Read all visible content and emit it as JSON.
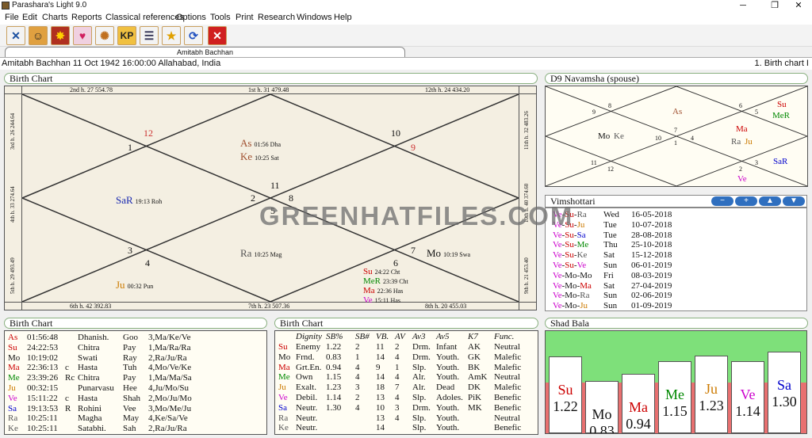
{
  "app": {
    "title": "Parashara's Light 9.0"
  },
  "menu": [
    "File",
    "Edit",
    "Charts",
    "Reports",
    "Classical references",
    "Options",
    "Tools",
    "Print",
    "Research",
    "Windows",
    "Help"
  ],
  "toolbar_icons": [
    "tools-icon",
    "person-icon",
    "sun-icon",
    "heart-icon",
    "wheel-icon",
    "kp-icon",
    "checklist-icon",
    "star-icon",
    "refresh-icon",
    "close-icon"
  ],
  "toolbar_kp": "KP",
  "tab": {
    "label": "Amitabh Bachhan"
  },
  "info": {
    "left": "Amitabh Bachhan 11 Oct 1942 16:00:00  Allahabad, India",
    "right": "1. Birth chart I"
  },
  "birth_chart": {
    "title": "Birth Chart",
    "edge_top": [
      "2nd h.  27  554.78",
      "1st h.  31  479.48",
      "12th h.  24  434.20"
    ],
    "edge_bottom": [
      "6th h.  42  392.83",
      "7th h.  23  507.36",
      "8th h.  20  455.03"
    ],
    "edge_left": [
      "3rd h.  26  244.64",
      "4th h.  33  274.64",
      "5th h.  29  493.49"
    ],
    "edge_right": [
      "11th h.  32  483.26",
      "10th h.  40  374.60",
      "9th h.  21  453.40"
    ],
    "signs": {
      "h1": "11",
      "h2": "12",
      "h3": "1",
      "h4": "2",
      "h5": "3",
      "h6": "4",
      "h7": "5",
      "h8": "6",
      "h9": "7",
      "h10": "8",
      "h11": "9",
      "h12": "10"
    },
    "planets": {
      "as": {
        "name": "As",
        "deg": "01:56 Dha"
      },
      "ke": {
        "name": "Ke",
        "deg": "10:25 Sat"
      },
      "sar": {
        "name": "SaR",
        "deg": "19:13 Roh"
      },
      "ra": {
        "name": "Ra",
        "deg": "10:25 Mag"
      },
      "ju": {
        "name": "Ju",
        "deg": "00:32 Pun"
      },
      "mo": {
        "name": "Mo",
        "deg": "10:19 Swa"
      },
      "su": {
        "name": "Su",
        "deg": "24:22 Cht"
      },
      "mer": {
        "name": "MeR",
        "deg": "23:39 Cht"
      },
      "ma": {
        "name": "Ma",
        "deg": "22:36 Has"
      },
      "ve": {
        "name": "Ve",
        "deg": "15:11 Has"
      }
    }
  },
  "d9": {
    "title": "D9 Navamsha  (spouse)",
    "signs": {
      "h1": "7",
      "h2": "8",
      "h3": "9",
      "h4": "10",
      "h5": "11",
      "h6": "12",
      "h7": "1",
      "h8": "2",
      "h9": "3",
      "h10": "4",
      "h11": "5",
      "h12": "6"
    },
    "cells": {
      "as": "As",
      "su": "Su",
      "mer": "MeR",
      "mo": "Mo",
      "ke": "Ke",
      "ma": "Ma",
      "ra": "Ra",
      "ju": "Ju",
      "sar": "SaR",
      "ve": "Ve"
    }
  },
  "vimshottari": {
    "title": "Vimshottari",
    "buttons": [
      "−",
      "+",
      "▲",
      "▼"
    ],
    "rows": [
      {
        "p": [
          {
            "t": "Ve",
            "c": "#cc00cc"
          },
          {
            "t": "-",
            "c": "#111"
          },
          {
            "t": "Su",
            "c": "#cc0000"
          },
          {
            "t": "-",
            "c": "#111"
          },
          {
            "t": "Ra",
            "c": "#555"
          }
        ],
        "day": "Wed",
        "date": "16-05-2018"
      },
      {
        "p": [
          {
            "t": "Ve",
            "c": "#cc00cc"
          },
          {
            "t": "-",
            "c": "#111"
          },
          {
            "t": "Su",
            "c": "#cc0000"
          },
          {
            "t": "-",
            "c": "#111"
          },
          {
            "t": "Ju",
            "c": "#cc7a00"
          }
        ],
        "day": "Tue",
        "date": "10-07-2018"
      },
      {
        "p": [
          {
            "t": "Ve",
            "c": "#cc00cc"
          },
          {
            "t": "-",
            "c": "#111"
          },
          {
            "t": "Su",
            "c": "#cc0000"
          },
          {
            "t": "-",
            "c": "#111"
          },
          {
            "t": "Sa",
            "c": "#0000cc"
          }
        ],
        "day": "Tue",
        "date": "28-08-2018"
      },
      {
        "p": [
          {
            "t": "Ve",
            "c": "#cc00cc"
          },
          {
            "t": "-",
            "c": "#111"
          },
          {
            "t": "Su",
            "c": "#cc0000"
          },
          {
            "t": "-",
            "c": "#111"
          },
          {
            "t": "Me",
            "c": "#008800"
          }
        ],
        "day": "Thu",
        "date": "25-10-2018"
      },
      {
        "p": [
          {
            "t": "Ve",
            "c": "#cc00cc"
          },
          {
            "t": "-",
            "c": "#111"
          },
          {
            "t": "Su",
            "c": "#cc0000"
          },
          {
            "t": "-",
            "c": "#111"
          },
          {
            "t": "Ke",
            "c": "#555"
          }
        ],
        "day": "Sat",
        "date": "15-12-2018"
      },
      {
        "p": [
          {
            "t": "Ve",
            "c": "#cc00cc"
          },
          {
            "t": "-",
            "c": "#111"
          },
          {
            "t": "Su",
            "c": "#cc0000"
          },
          {
            "t": "-",
            "c": "#111"
          },
          {
            "t": "Ve",
            "c": "#cc00cc"
          }
        ],
        "day": "Sun",
        "date": "06-01-2019"
      },
      {
        "p": [
          {
            "t": "Ve",
            "c": "#cc00cc"
          },
          {
            "t": "-",
            "c": "#111"
          },
          {
            "t": "Mo",
            "c": "#111"
          },
          {
            "t": "-",
            "c": "#111"
          },
          {
            "t": "Mo",
            "c": "#111"
          }
        ],
        "day": "Fri",
        "date": "08-03-2019"
      },
      {
        "p": [
          {
            "t": "Ve",
            "c": "#cc00cc"
          },
          {
            "t": "-",
            "c": "#111"
          },
          {
            "t": "Mo",
            "c": "#111"
          },
          {
            "t": "-",
            "c": "#111"
          },
          {
            "t": "Ma",
            "c": "#cc0000"
          }
        ],
        "day": "Sat",
        "date": "27-04-2019"
      },
      {
        "p": [
          {
            "t": "Ve",
            "c": "#cc00cc"
          },
          {
            "t": "-",
            "c": "#111"
          },
          {
            "t": "Mo",
            "c": "#111"
          },
          {
            "t": "-",
            "c": "#111"
          },
          {
            "t": "Ra",
            "c": "#555"
          }
        ],
        "day": "Sun",
        "date": "02-06-2019"
      },
      {
        "p": [
          {
            "t": "Ve",
            "c": "#cc00cc"
          },
          {
            "t": "-",
            "c": "#111"
          },
          {
            "t": "Mo",
            "c": "#111"
          },
          {
            "t": "-",
            "c": "#111"
          },
          {
            "t": "Ju",
            "c": "#cc7a00"
          }
        ],
        "day": "Sun",
        "date": "01-09-2019"
      }
    ]
  },
  "birth_list": {
    "title": "Birth Chart",
    "rows": [
      {
        "p": "As",
        "c": "#cc0000",
        "deg": "01:56:48",
        "f": "",
        "nak": "Dhanish.",
        "ab": "Goo",
        "pada": "3,Ma/Ke/Ve"
      },
      {
        "p": "Su",
        "c": "#cc0000",
        "deg": "24:22:53",
        "f": "",
        "nak": "Chitra",
        "ab": "Pay",
        "pada": "1,Ma/Ra/Ra"
      },
      {
        "p": "Mo",
        "c": "#111",
        "deg": "10:19:02",
        "f": "",
        "nak": "Swati",
        "ab": "Ray",
        "pada": "2,Ra/Ju/Ra"
      },
      {
        "p": "Ma",
        "c": "#cc0000",
        "deg": "22:36:13",
        "f": "c",
        "nak": "Hasta",
        "ab": "Tuh",
        "pada": "4,Mo/Ve/Ke"
      },
      {
        "p": "Me",
        "c": "#008800",
        "deg": "23:39:26",
        "f": "Rc",
        "nak": "Chitra",
        "ab": "Pay",
        "pada": "1,Ma/Ma/Sa"
      },
      {
        "p": "Ju",
        "c": "#cc7a00",
        "deg": "00:32:15",
        "f": "",
        "nak": "Punarvasu",
        "ab": "Hee",
        "pada": "4,Ju/Mo/Su"
      },
      {
        "p": "Ve",
        "c": "#cc00cc",
        "deg": "15:11:22",
        "f": "c",
        "nak": "Hasta",
        "ab": "Shah",
        "pada": "2,Mo/Ju/Mo"
      },
      {
        "p": "Sa",
        "c": "#0000cc",
        "deg": "19:13:53",
        "f": "R",
        "nak": "Rohini",
        "ab": "Vee",
        "pada": "3,Mo/Me/Ju"
      },
      {
        "p": "Ra",
        "c": "#555",
        "deg": "10:25:11",
        "f": "",
        "nak": "Magha",
        "ab": "May",
        "pada": "4,Ke/Sa/Ve"
      },
      {
        "p": "Ke",
        "c": "#555",
        "deg": "10:25:11",
        "f": "",
        "nak": "Satabhi.",
        "ab": "Sah",
        "pada": "2,Ra/Ju/Ra"
      }
    ]
  },
  "dignity": {
    "title": "Birth Chart",
    "headers": [
      "Dignity",
      "SB%",
      "SB#",
      "VB.",
      "AV",
      "Av3",
      "Av5",
      "K7",
      "Func."
    ],
    "rows": [
      {
        "p": "Su",
        "c": "#cc0000",
        "v": [
          "Enemy",
          "1.22",
          "2",
          "11",
          "2",
          "Drm.",
          "Infant",
          "AK",
          "Neutral"
        ]
      },
      {
        "p": "Mo",
        "c": "#111",
        "v": [
          "Frnd.",
          "0.83",
          "1",
          "14",
          "4",
          "Drm.",
          "Youth.",
          "GK",
          "Malefic"
        ]
      },
      {
        "p": "Ma",
        "c": "#cc0000",
        "v": [
          "Grt.En.",
          "0.94",
          "4",
          "9",
          "1",
          "Slp.",
          "Youth.",
          "BK",
          "Malefic"
        ]
      },
      {
        "p": "Me",
        "c": "#008800",
        "v": [
          "Own",
          "1.15",
          "4",
          "14",
          "4",
          "Alr.",
          "Youth.",
          "AmK",
          "Neutral"
        ]
      },
      {
        "p": "Ju",
        "c": "#cc7a00",
        "v": [
          "Exalt.",
          "1.23",
          "3",
          "18",
          "7",
          "Alr.",
          "Dead",
          "DK",
          "Malefic"
        ]
      },
      {
        "p": "Ve",
        "c": "#cc00cc",
        "v": [
          "Debil.",
          "1.14",
          "2",
          "13",
          "4",
          "Slp.",
          "Adoles.",
          "PiK",
          "Benefic"
        ]
      },
      {
        "p": "Sa",
        "c": "#0000cc",
        "v": [
          "Neutr.",
          "1.30",
          "4",
          "10",
          "3",
          "Drm.",
          "Youth.",
          "MK",
          "Benefic"
        ]
      },
      {
        "p": "Ra",
        "c": "#555",
        "v": [
          "Neutr.",
          "",
          "",
          "13",
          "4",
          "Slp.",
          "Youth.",
          "",
          "Neutral"
        ]
      },
      {
        "p": "Ke",
        "c": "#555",
        "v": [
          "Neutr.",
          "",
          "",
          "14",
          "",
          "Slp.",
          "Youth.",
          "",
          "Benefic"
        ]
      }
    ]
  },
  "shad_bala": {
    "title": "Shad Bala",
    "colors": {
      "good": "#7ee07a",
      "bad": "#e87070"
    },
    "bars": [
      {
        "p": "Su",
        "c": "#cc0000",
        "v": "1.22",
        "f": 1.22
      },
      {
        "p": "Mo",
        "c": "#111",
        "v": "0.83",
        "f": 0.83
      },
      {
        "p": "Ma",
        "c": "#cc0000",
        "v": "0.94",
        "f": 0.94
      },
      {
        "p": "Me",
        "c": "#008800",
        "v": "1.15",
        "f": 1.15
      },
      {
        "p": "Ju",
        "c": "#cc7a00",
        "v": "1.23",
        "f": 1.23
      },
      {
        "p": "Ve",
        "c": "#cc00cc",
        "v": "1.14",
        "f": 1.14
      },
      {
        "p": "Sa",
        "c": "#0000cc",
        "v": "1.30",
        "f": 1.3
      }
    ]
  },
  "watermark": "GREENHATFILES.COM"
}
